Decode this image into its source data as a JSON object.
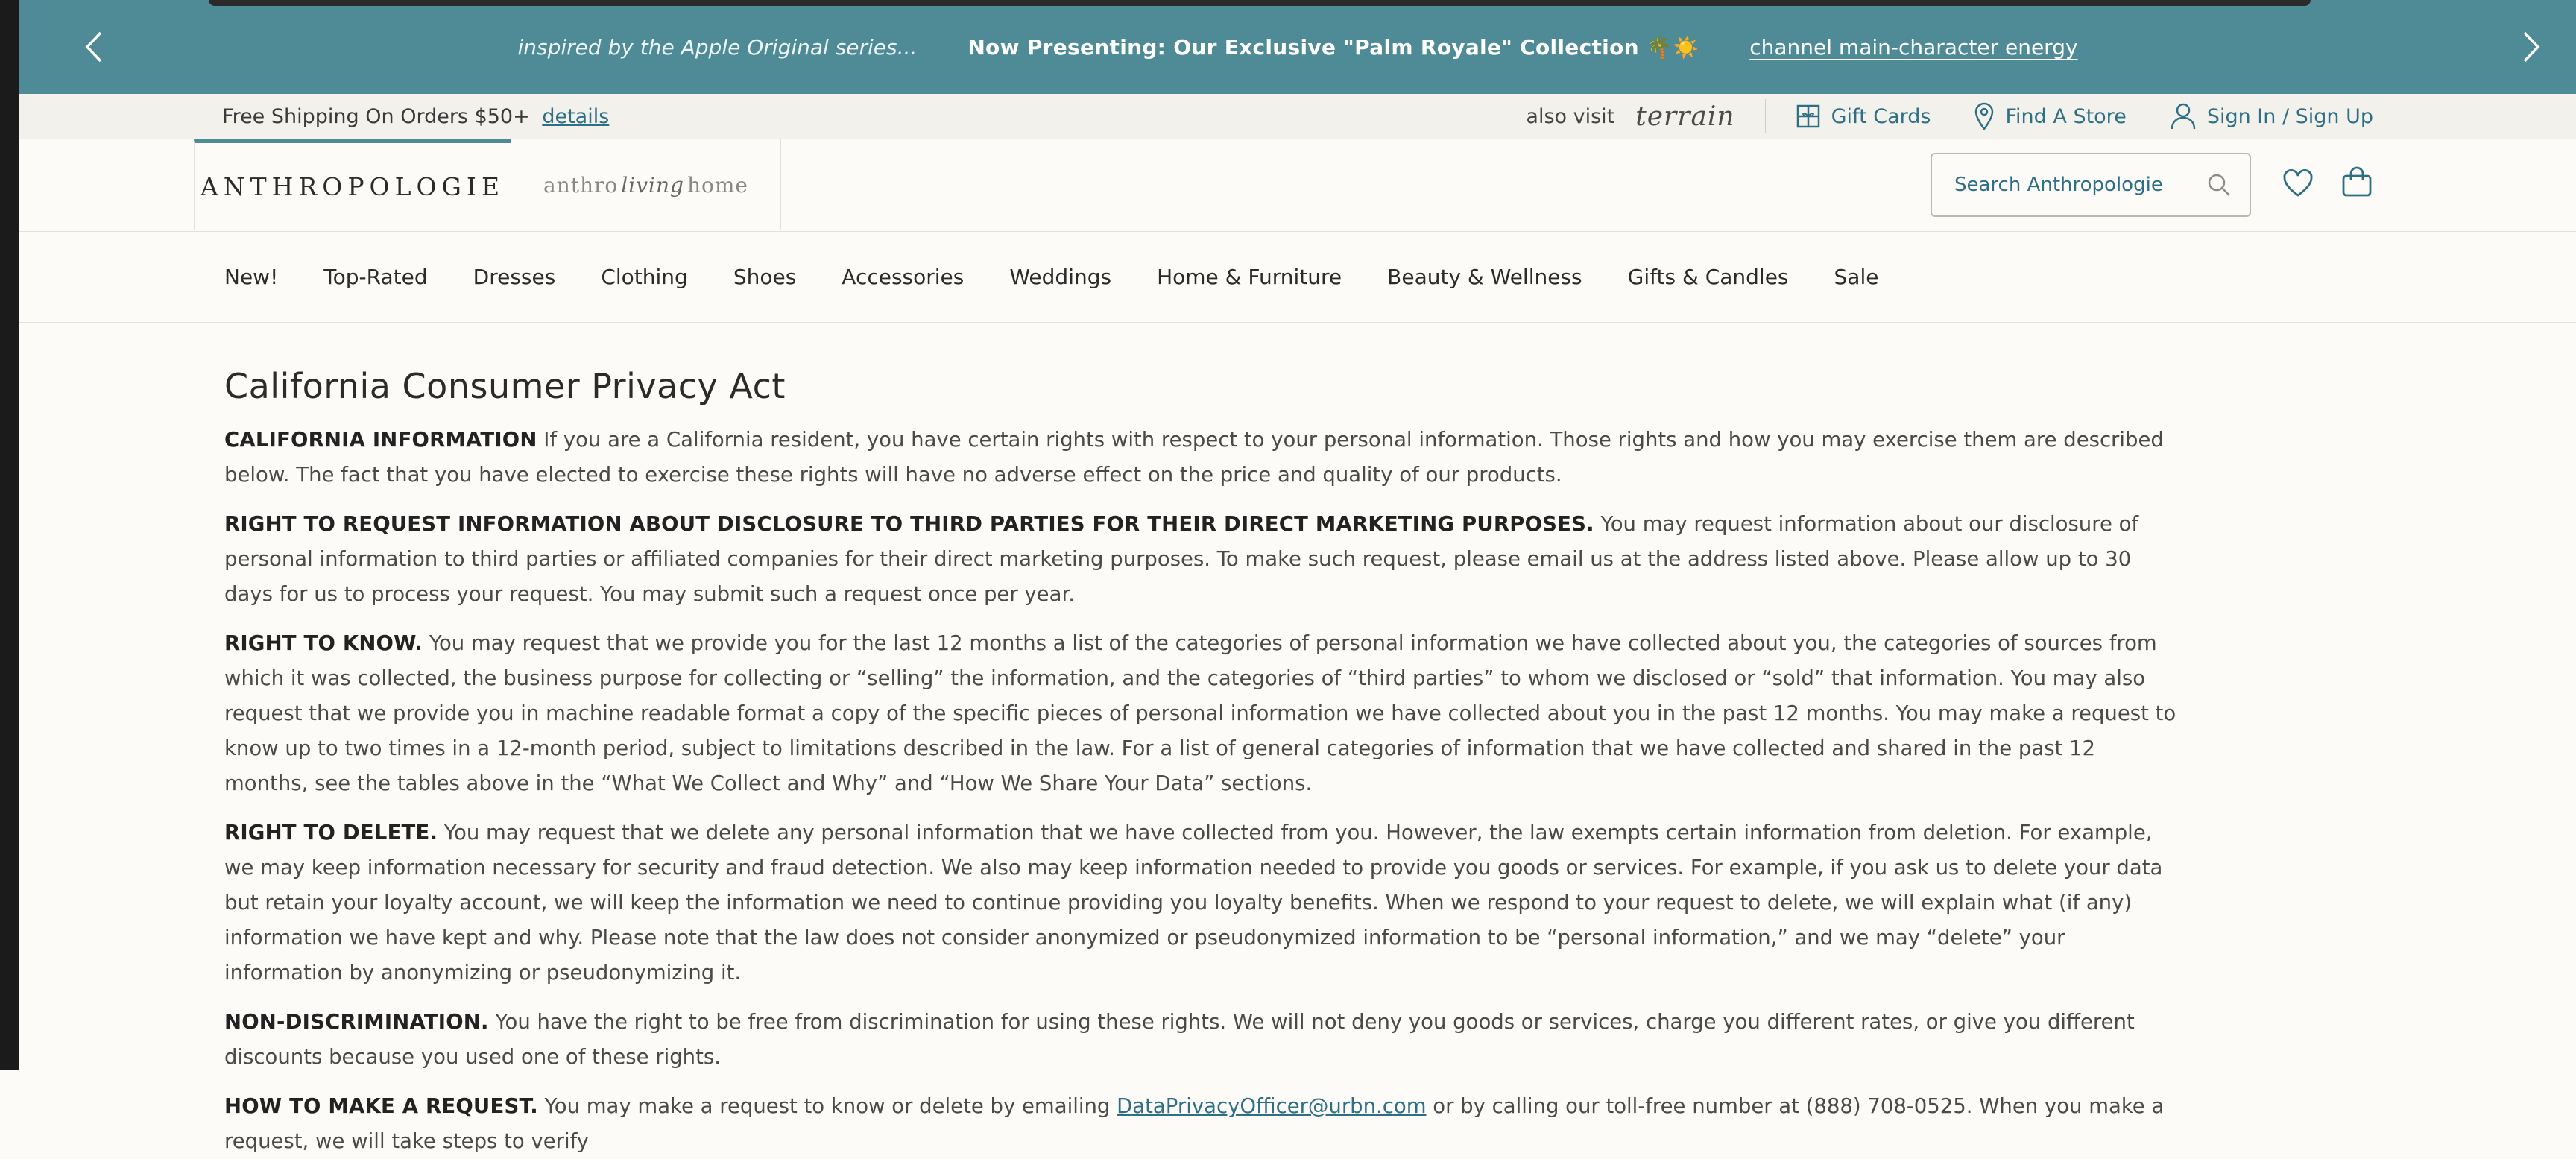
{
  "promo": {
    "left_message": "inspired by the Apple Original series...",
    "center_message": "Now Presenting: Our Exclusive \"Palm Royale\" Collection 🌴☀️",
    "right_link": "channel main-character energy"
  },
  "utility": {
    "shipping_text": "Free Shipping On Orders $50+",
    "shipping_link": "details",
    "also_visit": "also visit",
    "terrain": "terrain",
    "gift_cards": "Gift Cards",
    "find_store": "Find A Store",
    "sign_in": "Sign In / Sign Up"
  },
  "header": {
    "brand": "ANTHROPOLOGIE",
    "home_brand_pre": "anthro",
    "home_brand_living": "living",
    "home_brand_post": "home",
    "search_placeholder": "Search Anthropologie"
  },
  "nav": {
    "items": [
      "New!",
      "Top-Rated",
      "Dresses",
      "Clothing",
      "Shoes",
      "Accessories",
      "Weddings",
      "Home & Furniture",
      "Beauty & Wellness",
      "Gifts & Candles",
      "Sale"
    ]
  },
  "content": {
    "title": "California Consumer Privacy Act",
    "sections": [
      {
        "lead": "CALIFORNIA INFORMATION",
        "text": " If you are a California resident, you have certain rights with respect to your personal information. Those rights and how you may exercise them are described below. The fact that you have elected to exercise these rights will have no adverse effect on the price and quality of our products."
      },
      {
        "lead": "RIGHT TO REQUEST INFORMATION ABOUT DISCLOSURE TO THIRD PARTIES FOR THEIR DIRECT MARKETING PURPOSES.",
        "text": " You may request information about our disclosure of personal information to third parties or affiliated companies for their direct marketing purposes. To make such request, please email us at the address listed above. Please allow up to 30 days for us to process your request. You may submit such a request once per year."
      },
      {
        "lead": "RIGHT TO KNOW.",
        "text": " You may request that we provide you for the last 12 months a list of the categories of personal information we have collected about you, the categories of sources from which it was collected, the business purpose for collecting or “selling” the information, and the categories of “third parties” to whom we disclosed or “sold” that information. You may also request that we provide you in machine readable format a copy of the specific pieces of personal information we have collected about you in the past 12 months. You may make a request to know up to two times in a 12-month period, subject to limitations described in the law. For a list of general categories of information that we have collected and shared in the past 12 months, see the tables above in the “What We Collect and Why” and “How We Share Your Data” sections."
      },
      {
        "lead": "RIGHT TO DELETE.",
        "text": " You may request that we delete any personal information that we have collected from you. However, the law exempts certain information from deletion. For example, we may keep information necessary for security and fraud detection. We also may keep information needed to provide you goods or services. For example, if you ask us to delete your data but retain your loyalty account, we will keep the information we need to continue providing you loyalty benefits. When we respond to your request to delete, we will explain what (if any) information we have kept and why. Please note that the law does not consider anonymized or pseudonymized information to be “personal information,” and we may “delete” your information by anonymizing or pseudonymizing it."
      },
      {
        "lead": "NON-DISCRIMINATION.",
        "text": " You have the right to be free from discrimination for using these rights. We will not deny you goods or services, charge you different rates, or give you different discounts because you used one of these rights."
      }
    ],
    "request": {
      "lead": "HOW TO MAKE A REQUEST.",
      "text_before": " You may make a request to know or delete by emailing ",
      "email": "DataPrivacyOfficer@urbn.com",
      "text_after": " or by calling our toll-free number at (888) 708-0525. When you make a request, we will take steps to verify"
    }
  }
}
